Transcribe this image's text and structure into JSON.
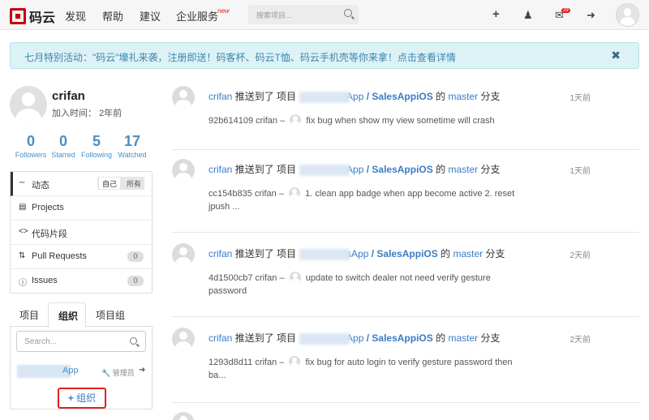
{
  "nav": {
    "logo_text": "码云",
    "items": [
      "发现",
      "帮助",
      "建议",
      "企业服务"
    ],
    "new_badge": "new",
    "search_placeholder": "搜索项目...",
    "mail_count": "29"
  },
  "notice": {
    "text_before": "七月特别活动：\"码云\"壕礼来袭，注册即送！码客杯、码云T恤、码云手机壳等你来拿！",
    "link": "点击查看详情",
    "close": "✖"
  },
  "profile": {
    "username": "crifan",
    "join_label": "加入时间：",
    "join_value": "2年前",
    "stats": [
      {
        "num": "0",
        "label": "Followers"
      },
      {
        "num": "0",
        "label": "Starred"
      },
      {
        "num": "5",
        "label": "Following"
      },
      {
        "num": "17",
        "label": "Watched"
      }
    ]
  },
  "menu": {
    "items": [
      {
        "icon": "rss-icon",
        "label": "动态"
      },
      {
        "icon": "file-icon",
        "label": "Projects"
      },
      {
        "icon": "code-icon",
        "label": "代码片段"
      },
      {
        "icon": "pull-request-icon",
        "label": "Pull Requests",
        "count": "0"
      },
      {
        "icon": "issue-icon",
        "label": "Issues",
        "count": "0"
      }
    ],
    "seg_on": "自己",
    "seg_off": "所有"
  },
  "tabs": [
    "项目",
    "组织",
    "项目组"
  ],
  "org": {
    "search_placeholder": "Search...",
    "name_suffix": "App",
    "role": "管理员",
    "add_label": "组织"
  },
  "feed": [
    {
      "user": "crifan",
      "action": "推送到了 项目",
      "repo_suffix": "App",
      "sep": " / ",
      "repo2": "SalesAppiOS",
      "of": "的",
      "branch": "master",
      "branch_word": "分支",
      "time": "1天前",
      "hash": "92b614109",
      "committer": "crifan",
      "dash": "–",
      "message": "fix bug when show my view sometime will crash"
    },
    {
      "user": "crifan",
      "action": "推送到了 项目",
      "repo_suffix": "App",
      "sep": " / ",
      "repo2": "SalesAppiOS",
      "of": "的",
      "branch": "master",
      "branch_word": "分支",
      "time": "1天前",
      "hash": "cc154b835",
      "committer": "crifan",
      "dash": "–",
      "message": "1. clean app badge when app become active 2. reset jpush ..."
    },
    {
      "user": "crifan",
      "action": "推送到了 项目",
      "repo_suffix": "sApp",
      "sep": " / ",
      "repo2": "SalesAppiOS",
      "of": "的",
      "branch": "master",
      "branch_word": "分支",
      "time": "2天前",
      "hash": "4d1500cb7",
      "committer": "crifan",
      "dash": "–",
      "message": "update to switch dealer not need verify gesture password"
    },
    {
      "user": "crifan",
      "action": "推送到了 项目",
      "repo_suffix": "App",
      "sep": " / ",
      "repo2": "SalesAppiOS",
      "of": "的",
      "branch": "master",
      "branch_word": "分支",
      "time": "2天前",
      "hash": "1293d8d11",
      "committer": "crifan",
      "dash": "–",
      "message": "fix bug for auto login to verify gesture password then ba..."
    }
  ]
}
